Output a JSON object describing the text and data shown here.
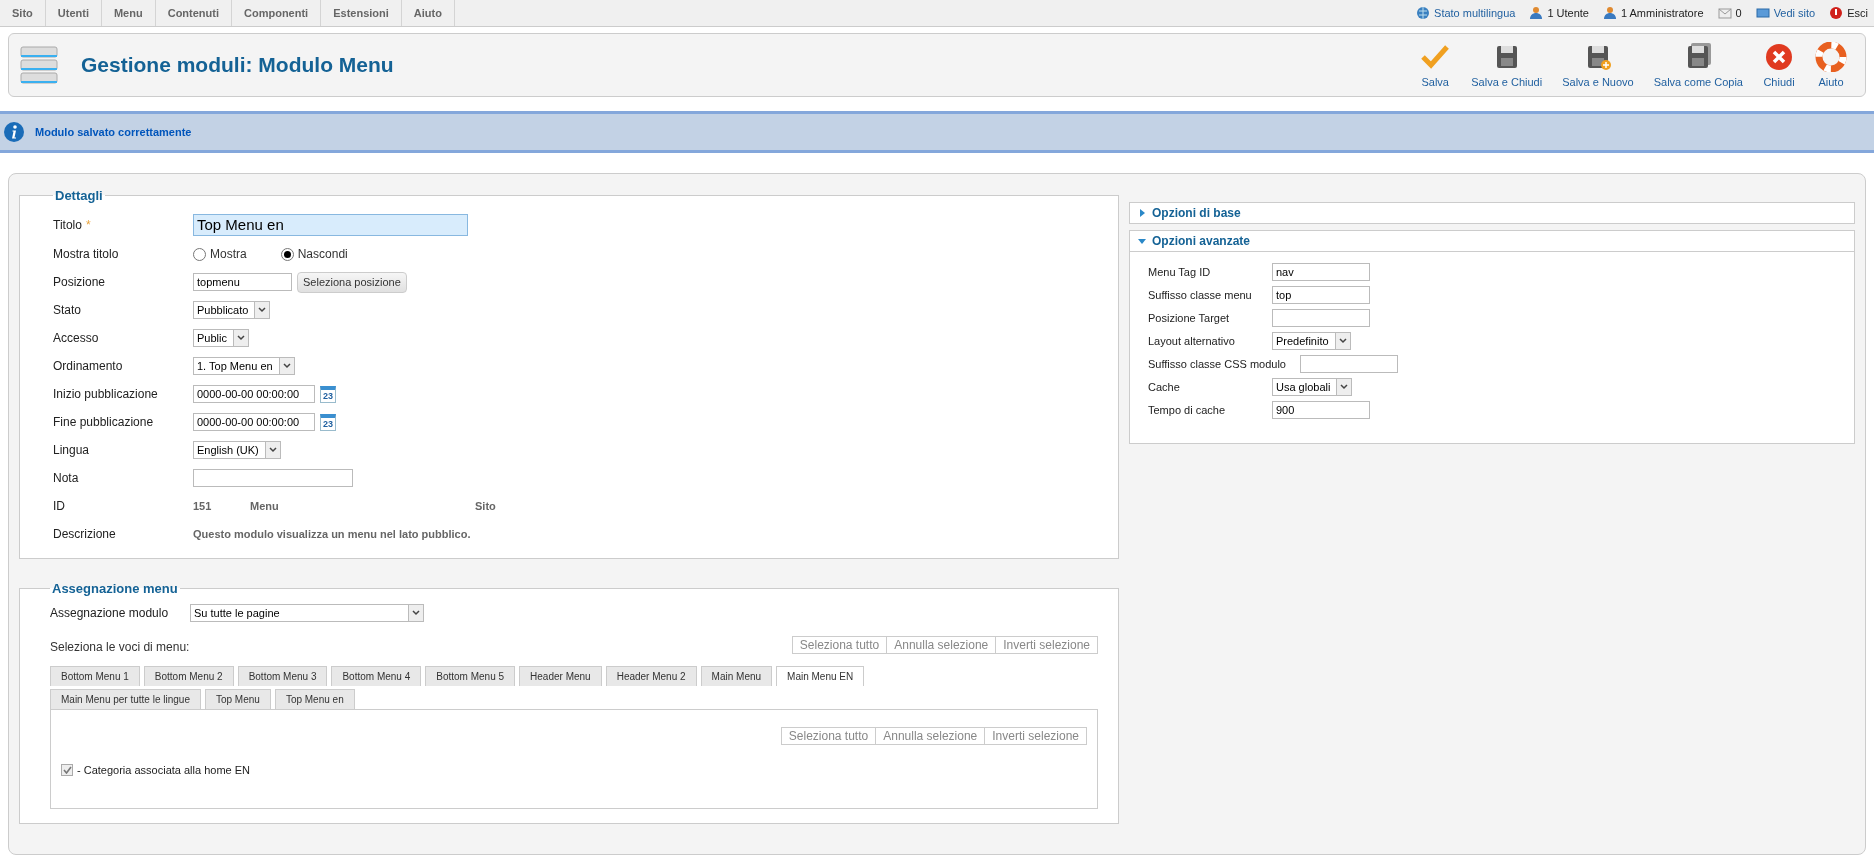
{
  "top_menu": [
    "Sito",
    "Utenti",
    "Menu",
    "Contenuti",
    "Componenti",
    "Estensioni",
    "Aiuto"
  ],
  "status_items": [
    {
      "kind": "globe",
      "label": "Stato multilingua",
      "link": true
    },
    {
      "kind": "user",
      "label": "1 Utente",
      "link": false
    },
    {
      "kind": "user",
      "label": "1 Amministratore",
      "link": false
    },
    {
      "kind": "mail",
      "label": "0",
      "link": false
    },
    {
      "kind": "screen",
      "label": "Vedi sito",
      "link": true
    },
    {
      "kind": "logout",
      "label": "Esci",
      "link": false
    }
  ],
  "header": {
    "title": "Gestione moduli: Modulo Menu"
  },
  "toolbar": [
    {
      "kind": "check",
      "label": "Salva"
    },
    {
      "kind": "disk",
      "label": "Salva e Chiudi"
    },
    {
      "kind": "disk_plus",
      "label": "Salva e Nuovo"
    },
    {
      "kind": "disk_copy",
      "label": "Salva come Copia"
    },
    {
      "kind": "close",
      "label": "Chiudi"
    },
    {
      "kind": "help",
      "label": "Aiuto"
    }
  ],
  "message": "Modulo salvato correttamente",
  "details": {
    "legend": "Dettagli",
    "fields": [
      {
        "kind": "title_text",
        "label": "Titolo",
        "required": true,
        "mark": "*",
        "value": "Top Menu en",
        "focused": true
      },
      {
        "kind": "radio",
        "label": "Mostra titolo",
        "options": [
          {
            "label": "Mostra",
            "selected": false
          },
          {
            "label": "Nascondi",
            "selected": true
          }
        ]
      },
      {
        "kind": "text_button",
        "label": "Posizione",
        "value": "topmenu",
        "button": "Seleziona posizione"
      },
      {
        "kind": "select",
        "label": "Stato",
        "value": "Pubblicato"
      },
      {
        "kind": "select",
        "label": "Accesso",
        "value": "Public"
      },
      {
        "kind": "select",
        "label": "Ordinamento",
        "value": "1. Top Menu en"
      },
      {
        "kind": "date",
        "label": "Inizio pubblicazione",
        "value": "0000-00-00 00:00:00",
        "icon_text": "23"
      },
      {
        "kind": "date",
        "label": "Fine pubblicazione",
        "value": "0000-00-00 00:00:00",
        "icon_text": "23"
      },
      {
        "kind": "select",
        "label": "Lingua",
        "value": "English (UK)"
      },
      {
        "kind": "text",
        "label": "Nota",
        "focused": false
      },
      {
        "kind": "info",
        "label": "ID",
        "values": [
          "151",
          "Menu",
          "Sito"
        ]
      },
      {
        "kind": "description",
        "label": "Descrizione",
        "value": "Questo modulo visualizza un menu nel lato pubblico."
      }
    ]
  },
  "panels": [
    {
      "title": "Opzioni di base",
      "expanded": false
    },
    {
      "title": "Opzioni avanzate",
      "expanded": true,
      "fields": [
        {
          "kind": "text",
          "label": "Menu Tag ID",
          "value": "nav"
        },
        {
          "kind": "text",
          "label": "Suffisso classe menu",
          "value": "top"
        },
        {
          "kind": "text",
          "label": "Posizione Target"
        },
        {
          "kind": "select",
          "label": "Layout alternativo",
          "value": "Predefinito"
        },
        {
          "kind": "text",
          "label": "Suffisso classe CSS modulo"
        },
        {
          "kind": "select",
          "label": "Cache",
          "value": "Usa globali"
        },
        {
          "kind": "text",
          "label": "Tempo di cache",
          "value": "900"
        }
      ]
    }
  ],
  "assignment": {
    "legend": "Assegnazione menu",
    "select_label": "Assegnazione modulo",
    "select_value": "Su tutte le pagine",
    "items_label": "Seleziona le voci di menu:",
    "buttons": [
      "Seleziona tutto",
      "Annulla selezione",
      "Inverti selezione"
    ],
    "tabs": [
      {
        "label": "Bottom Menu 1",
        "selected": false
      },
      {
        "label": "Bottom Menu 2",
        "selected": false
      },
      {
        "label": "Bottom Menu 3",
        "selected": false
      },
      {
        "label": "Bottom Menu 4",
        "selected": false
      },
      {
        "label": "Bottom Menu 5",
        "selected": false
      },
      {
        "label": "Header Menu",
        "selected": false
      },
      {
        "label": "Header Menu 2",
        "selected": false
      },
      {
        "label": "Main Menu",
        "selected": false
      },
      {
        "label": "Main Menu EN",
        "selected": true
      },
      {
        "label": "Main Menu per tutte le lingue",
        "selected": false
      },
      {
        "label": "Top Menu",
        "selected": false
      },
      {
        "label": "Top Menu en",
        "selected": false
      }
    ],
    "tab_buttons": [
      "Seleziona tutto",
      "Annulla selezione",
      "Inverti selezione"
    ],
    "items": [
      {
        "label": "- Categoria associata alla home EN",
        "checked": true
      }
    ]
  }
}
